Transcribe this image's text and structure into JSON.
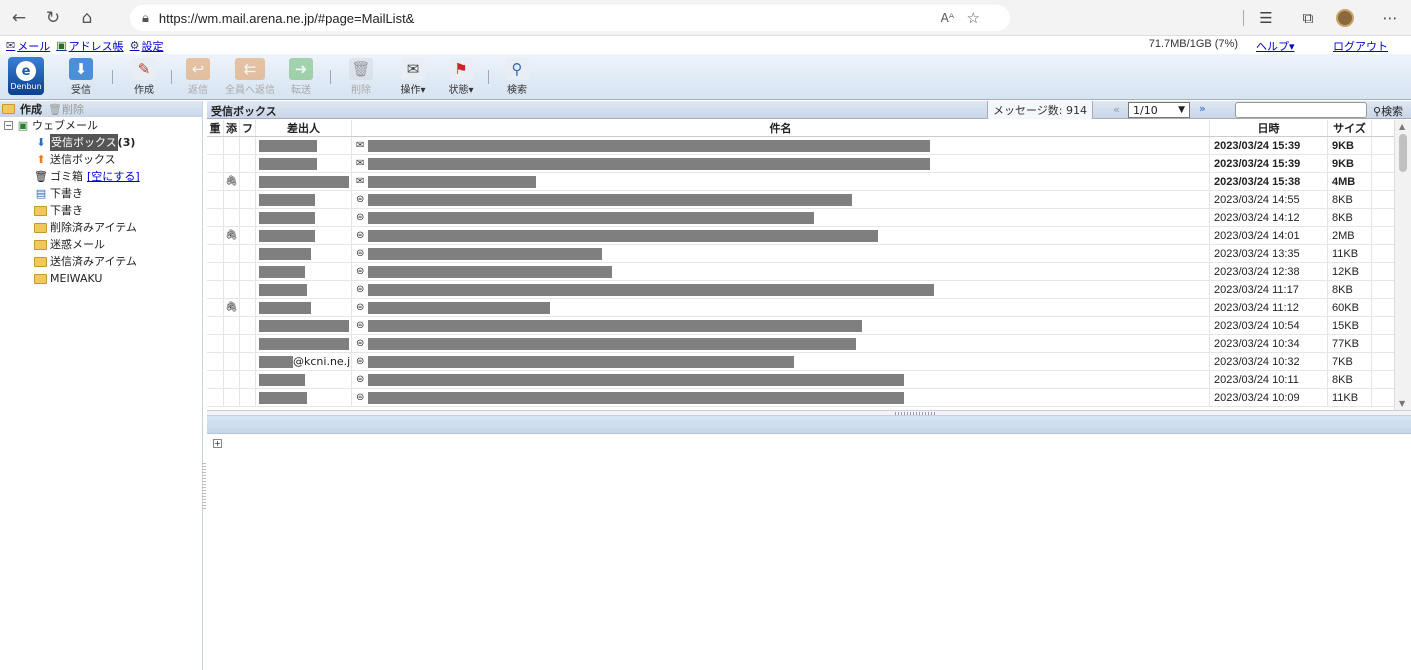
{
  "browser": {
    "url": "https://wm.mail.arena.ne.jp/#page=MailList&",
    "reader_label": "Aᴬ"
  },
  "menubar": {
    "mail": "メール",
    "addressbook": "アドレス帳",
    "settings": "設定",
    "quota": "71.7MB/1GB (7%)",
    "help": "ヘルプ▾",
    "logout": "ログアウト"
  },
  "toolbar": {
    "logo_text": "Denbun",
    "receive": "受信",
    "compose": "作成",
    "reply": "返信",
    "reply_all": "全員へ返信",
    "forward": "転送",
    "delete": "削除",
    "operation": "操作▾",
    "status": "状態▾",
    "search": "検索"
  },
  "leftpane": {
    "create": "作成",
    "delete": "削除",
    "root": "ウェブメール",
    "inbox": "受信ボックス",
    "inbox_unread": "(3)",
    "outbox": "送信ボックス",
    "trash": "ゴミ箱",
    "empty_trash": "[空にする]",
    "drafts1": "下書き",
    "drafts2": "下書き",
    "deleted_items": "削除済みアイテム",
    "junk": "迷惑メール",
    "sent_items": "送信済みアイテム",
    "meiwaku": "MEIWAKU"
  },
  "mailbox": {
    "title": "受信ボックス",
    "count": "メッセージ数: 914",
    "page": "1/10",
    "search_btn": "検索",
    "columns": {
      "importance": "重",
      "attach": "添",
      "flag": "フ",
      "sender": "差出人",
      "subject": "件名",
      "date": "日時",
      "size": "サイズ"
    },
    "rows": [
      {
        "attach": "",
        "sender_w": 58,
        "sender_text": "",
        "subject_w": 562,
        "date": "2023/03/24 15:39",
        "size": "9KB",
        "unread": true
      },
      {
        "attach": "",
        "sender_w": 58,
        "sender_text": "",
        "subject_w": 562,
        "date": "2023/03/24 15:39",
        "size": "9KB",
        "unread": true
      },
      {
        "attach": "📎",
        "sender_w": 90,
        "sender_text": "",
        "subject_w": 168,
        "date": "2023/03/24 15:38",
        "size": "4MB",
        "unread": true
      },
      {
        "attach": "",
        "sender_w": 56,
        "sender_text": "",
        "subject_w": 484,
        "date": "2023/03/24 14:55",
        "size": "8KB",
        "unread": false
      },
      {
        "attach": "",
        "sender_w": 56,
        "sender_text": "",
        "subject_w": 446,
        "date": "2023/03/24 14:12",
        "size": "8KB",
        "unread": false
      },
      {
        "attach": "📎",
        "sender_w": 56,
        "sender_text": "",
        "subject_w": 510,
        "date": "2023/03/24 14:01",
        "size": "2MB",
        "unread": false
      },
      {
        "attach": "",
        "sender_w": 52,
        "sender_text": "",
        "subject_w": 234,
        "date": "2023/03/24 13:35",
        "size": "11KB",
        "unread": false
      },
      {
        "attach": "",
        "sender_w": 46,
        "sender_text": "",
        "subject_w": 244,
        "date": "2023/03/24 12:38",
        "size": "12KB",
        "unread": false
      },
      {
        "attach": "",
        "sender_w": 48,
        "sender_text": "",
        "subject_w": 566,
        "date": "2023/03/24 11:17",
        "size": "8KB",
        "unread": false
      },
      {
        "attach": "📎",
        "sender_w": 52,
        "sender_text": "",
        "subject_w": 182,
        "date": "2023/03/24 11:12",
        "size": "60KB",
        "unread": false
      },
      {
        "attach": "",
        "sender_w": 90,
        "sender_text": "",
        "subject_w": 494,
        "date": "2023/03/24 10:54",
        "size": "15KB",
        "unread": false
      },
      {
        "attach": "",
        "sender_w": 90,
        "sender_text": "",
        "subject_w": 488,
        "date": "2023/03/24 10:34",
        "size": "77KB",
        "unread": false
      },
      {
        "attach": "",
        "sender_w": 34,
        "sender_text": "@kcni.ne.j",
        "subject_w": 426,
        "date": "2023/03/24 10:32",
        "size": "7KB",
        "unread": false
      },
      {
        "attach": "",
        "sender_w": 46,
        "sender_text": "",
        "subject_w": 536,
        "date": "2023/03/24 10:11",
        "size": "8KB",
        "unread": false
      },
      {
        "attach": "",
        "sender_w": 48,
        "sender_text": "",
        "subject_w": 536,
        "date": "2023/03/24 10:09",
        "size": "11KB",
        "unread": false
      }
    ]
  }
}
